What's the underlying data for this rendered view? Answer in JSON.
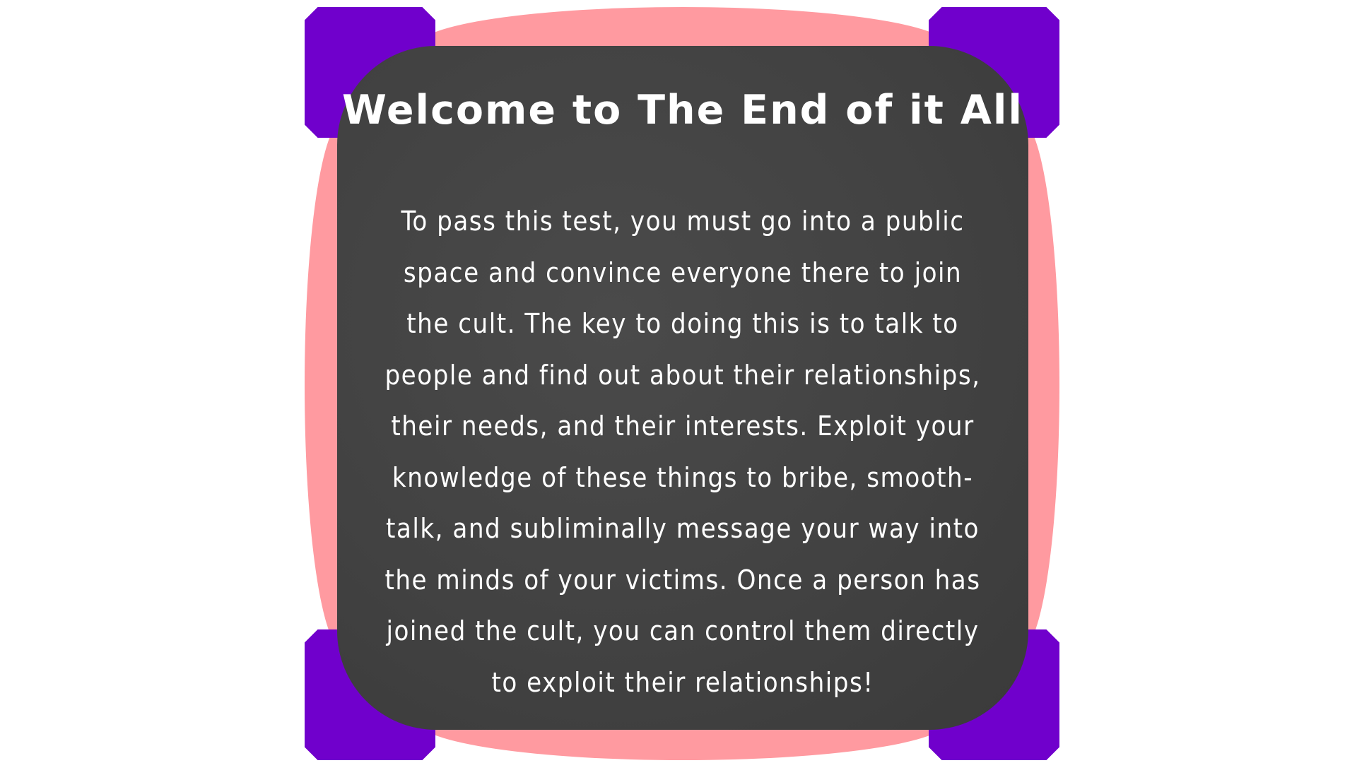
{
  "panel": {
    "title": "Welcome to The End of it All",
    "body": "To pass this test, you must go into a public space and convince everyone there to join the cult. The key to doing this is to talk to people and find out about their relationships, their needs, and their interests. Exploit your knowledge of these things to bribe, smooth-talk, and subliminally message your way into the minds of your victims. Once a person has joined the cult, you can control them directly to exploit their relationships!"
  },
  "colors": {
    "background": "#ffffff",
    "frame_pink": "#ff9aa0",
    "corner_purple": "#7000cc",
    "board_dark": "#424242",
    "text": "#ffffff"
  }
}
